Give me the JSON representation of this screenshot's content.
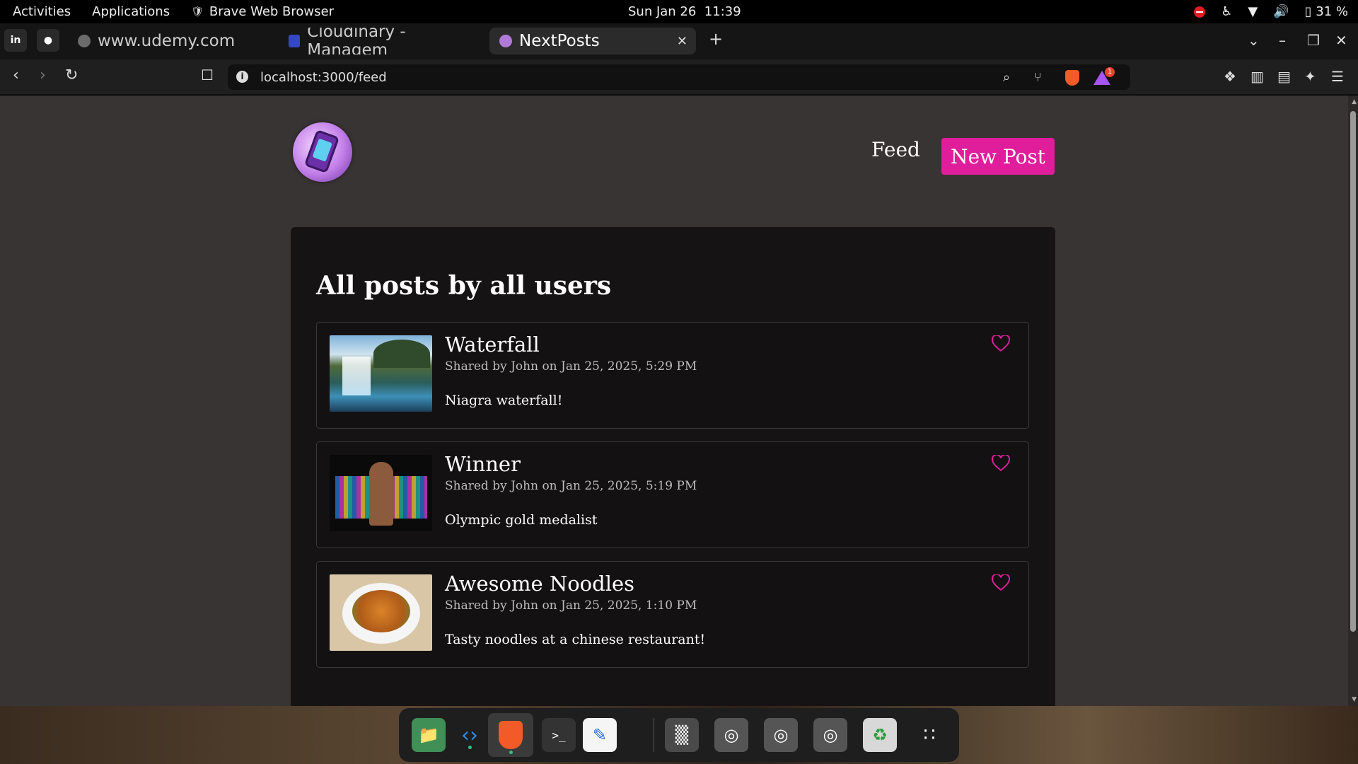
{
  "system_bar": {
    "activities": "Activities",
    "applications": "Applications",
    "active_app": "Brave Web Browser",
    "date": "Sun Jan 26",
    "time": "11:39",
    "battery": "31 %"
  },
  "browser": {
    "tabs": [
      {
        "label": "www.udemy.com",
        "favicon": "udemy-icon"
      },
      {
        "label": "Cloudinary - Managem",
        "favicon": "cloudinary-icon"
      },
      {
        "label": "NextPosts",
        "favicon": "nextposts-icon",
        "active": true
      }
    ],
    "url": "localhost:3000/feed",
    "rewards_badge": "1",
    "accent_color": "#e01e9b"
  },
  "page": {
    "nav": {
      "feed_label": "Feed",
      "new_post_label": "New Post"
    },
    "title": "All posts by all users",
    "posts": [
      {
        "title": "Waterfall",
        "meta": "Shared by John on Jan 25, 2025, 5:29 PM",
        "body": "Niagra waterfall!",
        "image": "waterfall-photo"
      },
      {
        "title": "Winner",
        "meta": "Shared by John on Jan 25, 2025, 5:19 PM",
        "body": "Olympic gold medalist",
        "image": "medalist-photo"
      },
      {
        "title": "Awesome Noodles",
        "meta": "Shared by John on Jan 25, 2025, 1:10 PM",
        "body": "Tasty noodles at a chinese restaurant!",
        "image": "noodles-photo"
      }
    ]
  },
  "dock": {
    "items": [
      "files-icon",
      "vscode-icon",
      "brave-icon",
      "terminal-icon",
      "text-editor-icon",
      "disk-icon",
      "optical-drive-icon",
      "optical-drive-icon",
      "optical-drive-icon",
      "trash-icon",
      "app-grid-icon"
    ]
  }
}
